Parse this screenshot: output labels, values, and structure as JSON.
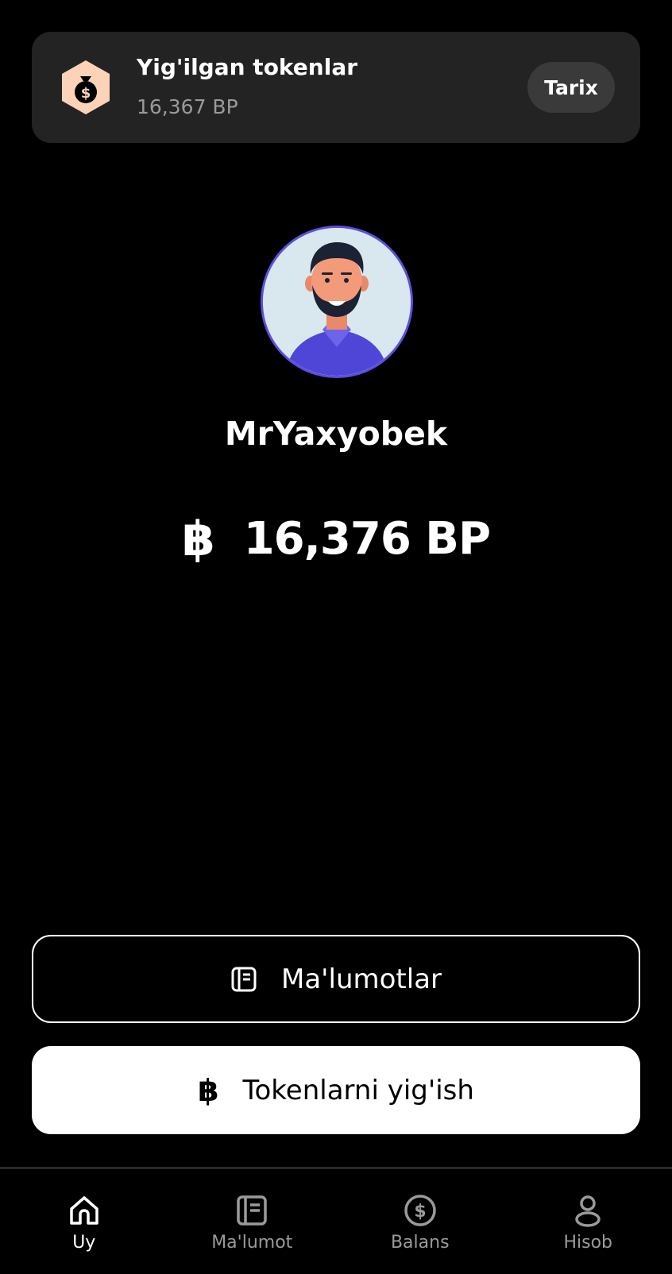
{
  "token_card": {
    "title": "Yig'ilgan tokenlar",
    "subtitle": "16,367 BP",
    "history_button": "Tarix",
    "icon": "money-bag-icon",
    "icon_bg": "#fdd3b8"
  },
  "profile": {
    "username": "MrYaxyobek",
    "balance_symbol": "฿",
    "balance": "16,376 BP",
    "avatar_icon": "avatar-man-icon"
  },
  "actions": {
    "info_label": "Ma'lumotlar",
    "info_icon": "notebook-icon",
    "collect_label": "Tokenlarni yig'ish",
    "collect_icon": "baht-icon",
    "collect_symbol": "฿"
  },
  "nav": {
    "items": [
      {
        "label": "Uy",
        "icon": "home-icon",
        "active": true
      },
      {
        "label": "Ma'lumot",
        "icon": "notebook-icon",
        "active": false
      },
      {
        "label": "Balans",
        "icon": "dollar-circle-icon",
        "active": false
      },
      {
        "label": "Hisob",
        "icon": "user-icon",
        "active": false
      }
    ]
  },
  "colors": {
    "background": "#000000",
    "card": "#232323",
    "accent_avatar_ring": "#5b4fe0",
    "muted_text": "#9a9a9a"
  }
}
